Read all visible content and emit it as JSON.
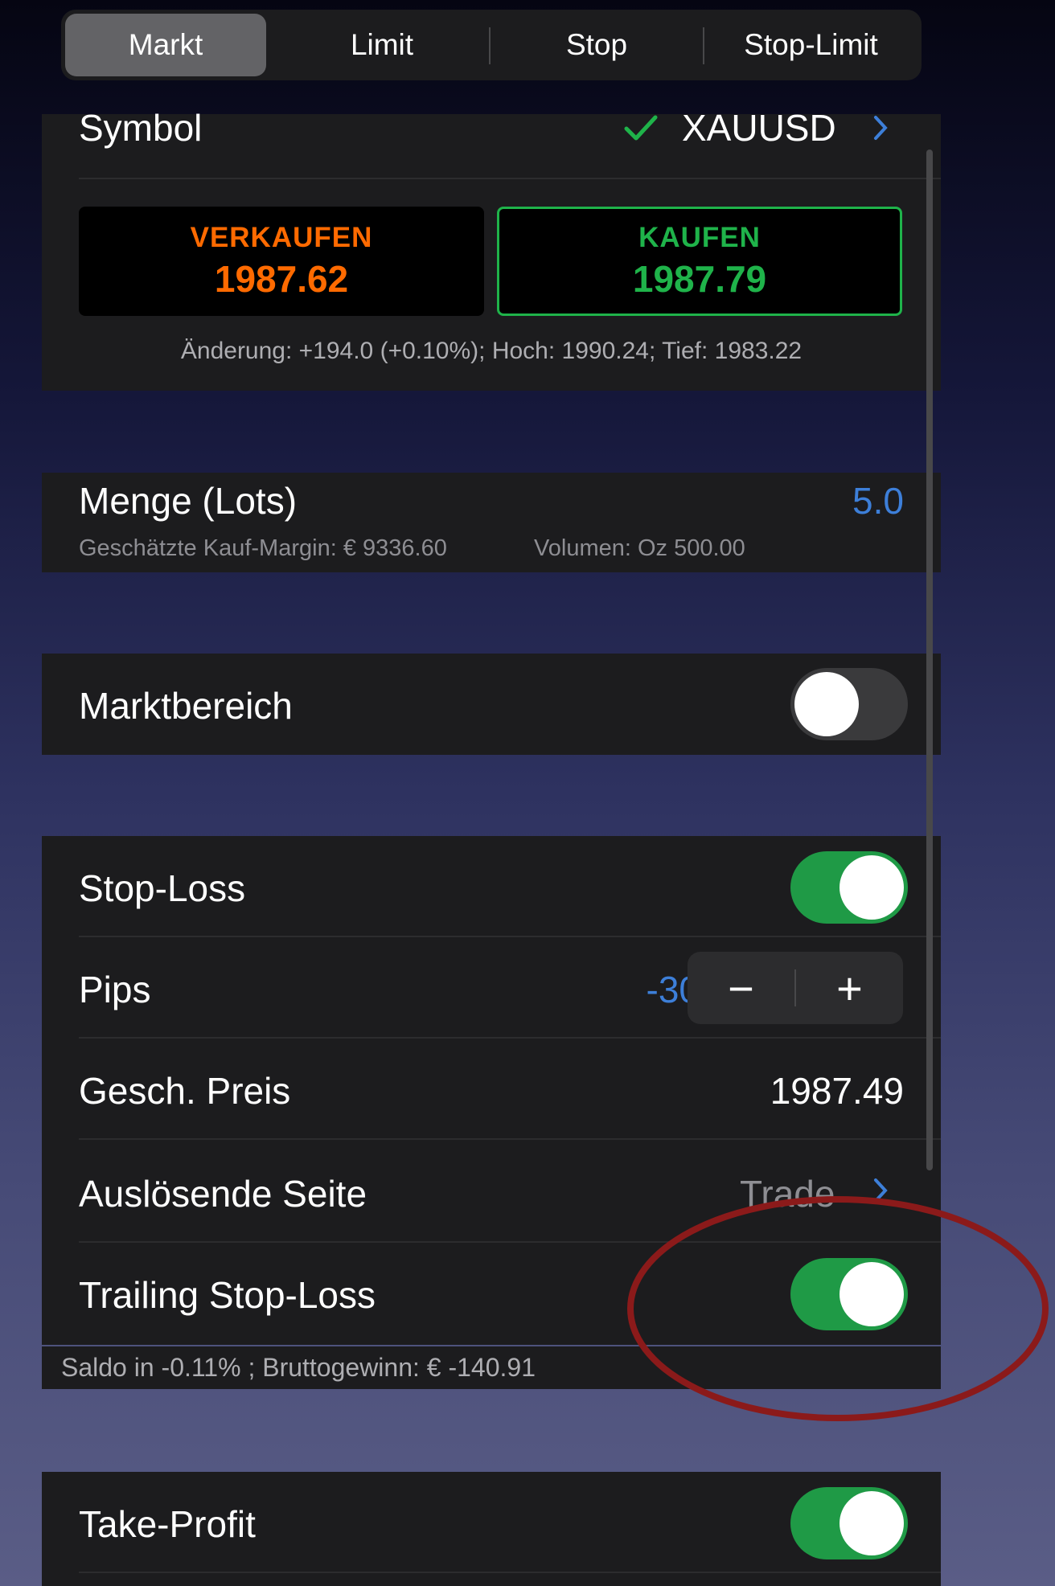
{
  "tabs": [
    "Markt",
    "Limit",
    "Stop",
    "Stop-Limit"
  ],
  "symbol": {
    "label": "Symbol",
    "value": "XAUUSD"
  },
  "sell": {
    "label": "VERKAUFEN",
    "price": "1987.62",
    "color": "#ff6a00"
  },
  "buy": {
    "label": "KAUFEN",
    "price": "1987.79",
    "color": "#1fb34a"
  },
  "change_info": "Änderung: +194.0 (+0.10%); Hoch: 1990.24; Tief: 1983.22",
  "quantity": {
    "label": "Menge (Lots)",
    "value": "5.0",
    "margin": "Geschätzte Kauf-Margin: € 9336.60",
    "volume": "Volumen: Oz 500.00"
  },
  "market_range": {
    "label": "Marktbereich",
    "on": false
  },
  "stop_loss": {
    "label": "Stop-Loss",
    "on": true
  },
  "pips": {
    "label": "Pips",
    "value": "-30",
    "minus": "−",
    "plus": "+"
  },
  "est_price": {
    "label": "Gesch. Preis",
    "value": "1987.49"
  },
  "trigger_side": {
    "label": "Auslösende Seite",
    "value": "Trade"
  },
  "trailing": {
    "label": "Trailing Stop-Loss",
    "on": true
  },
  "balance_info": "Saldo in -0.11% ; Bruttogewinn: € -140.91",
  "take_profit": {
    "label": "Take-Profit",
    "on": true
  },
  "colors": {
    "accent_blue": "#3d7fd9",
    "toggle_green": "#1f9a46",
    "annotation_red": "#8b1a1a"
  }
}
